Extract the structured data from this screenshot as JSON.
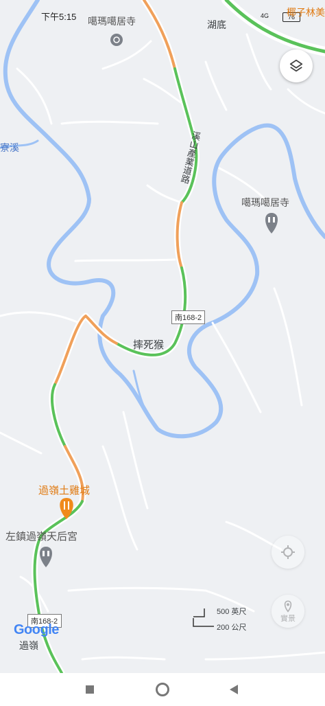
{
  "status_bar": {
    "time": "下午5:15",
    "network": "4G",
    "battery": "76"
  },
  "map": {
    "labels": {
      "temple_top": "噶瑪噶居寺",
      "hudi": "湖底",
      "top_right_poi": "椰子林美",
      "liao_xi": "寮溪",
      "road_name": "溪山產業道路",
      "temple_poi": "噶瑪噶居寺",
      "shuaisihou": "摔死猴",
      "restaurant": "過嶺土雞城",
      "temple_bottom": "左鎮過嶺天后宮",
      "village": "過嶺"
    },
    "route_shields": [
      "南168-2",
      "南168-2"
    ],
    "scale": {
      "imperial": "500 英尺",
      "metric": "200 公尺"
    },
    "attribution": "Google",
    "street_view_label": "實景"
  },
  "icons": {
    "layers": "layers-icon",
    "location": "my-location-icon",
    "street_view": "street-view-icon",
    "restaurant": "fork-knife-icon",
    "temple": "temple-icon"
  },
  "colors": {
    "land": "#eef0f3",
    "water": "#9ec2f5",
    "road": "#ffffff",
    "traffic_green": "#5ac25a",
    "traffic_orange": "#f0a05a",
    "poi_orange": "#f08a1c",
    "poi_gray": "#7c8189"
  }
}
